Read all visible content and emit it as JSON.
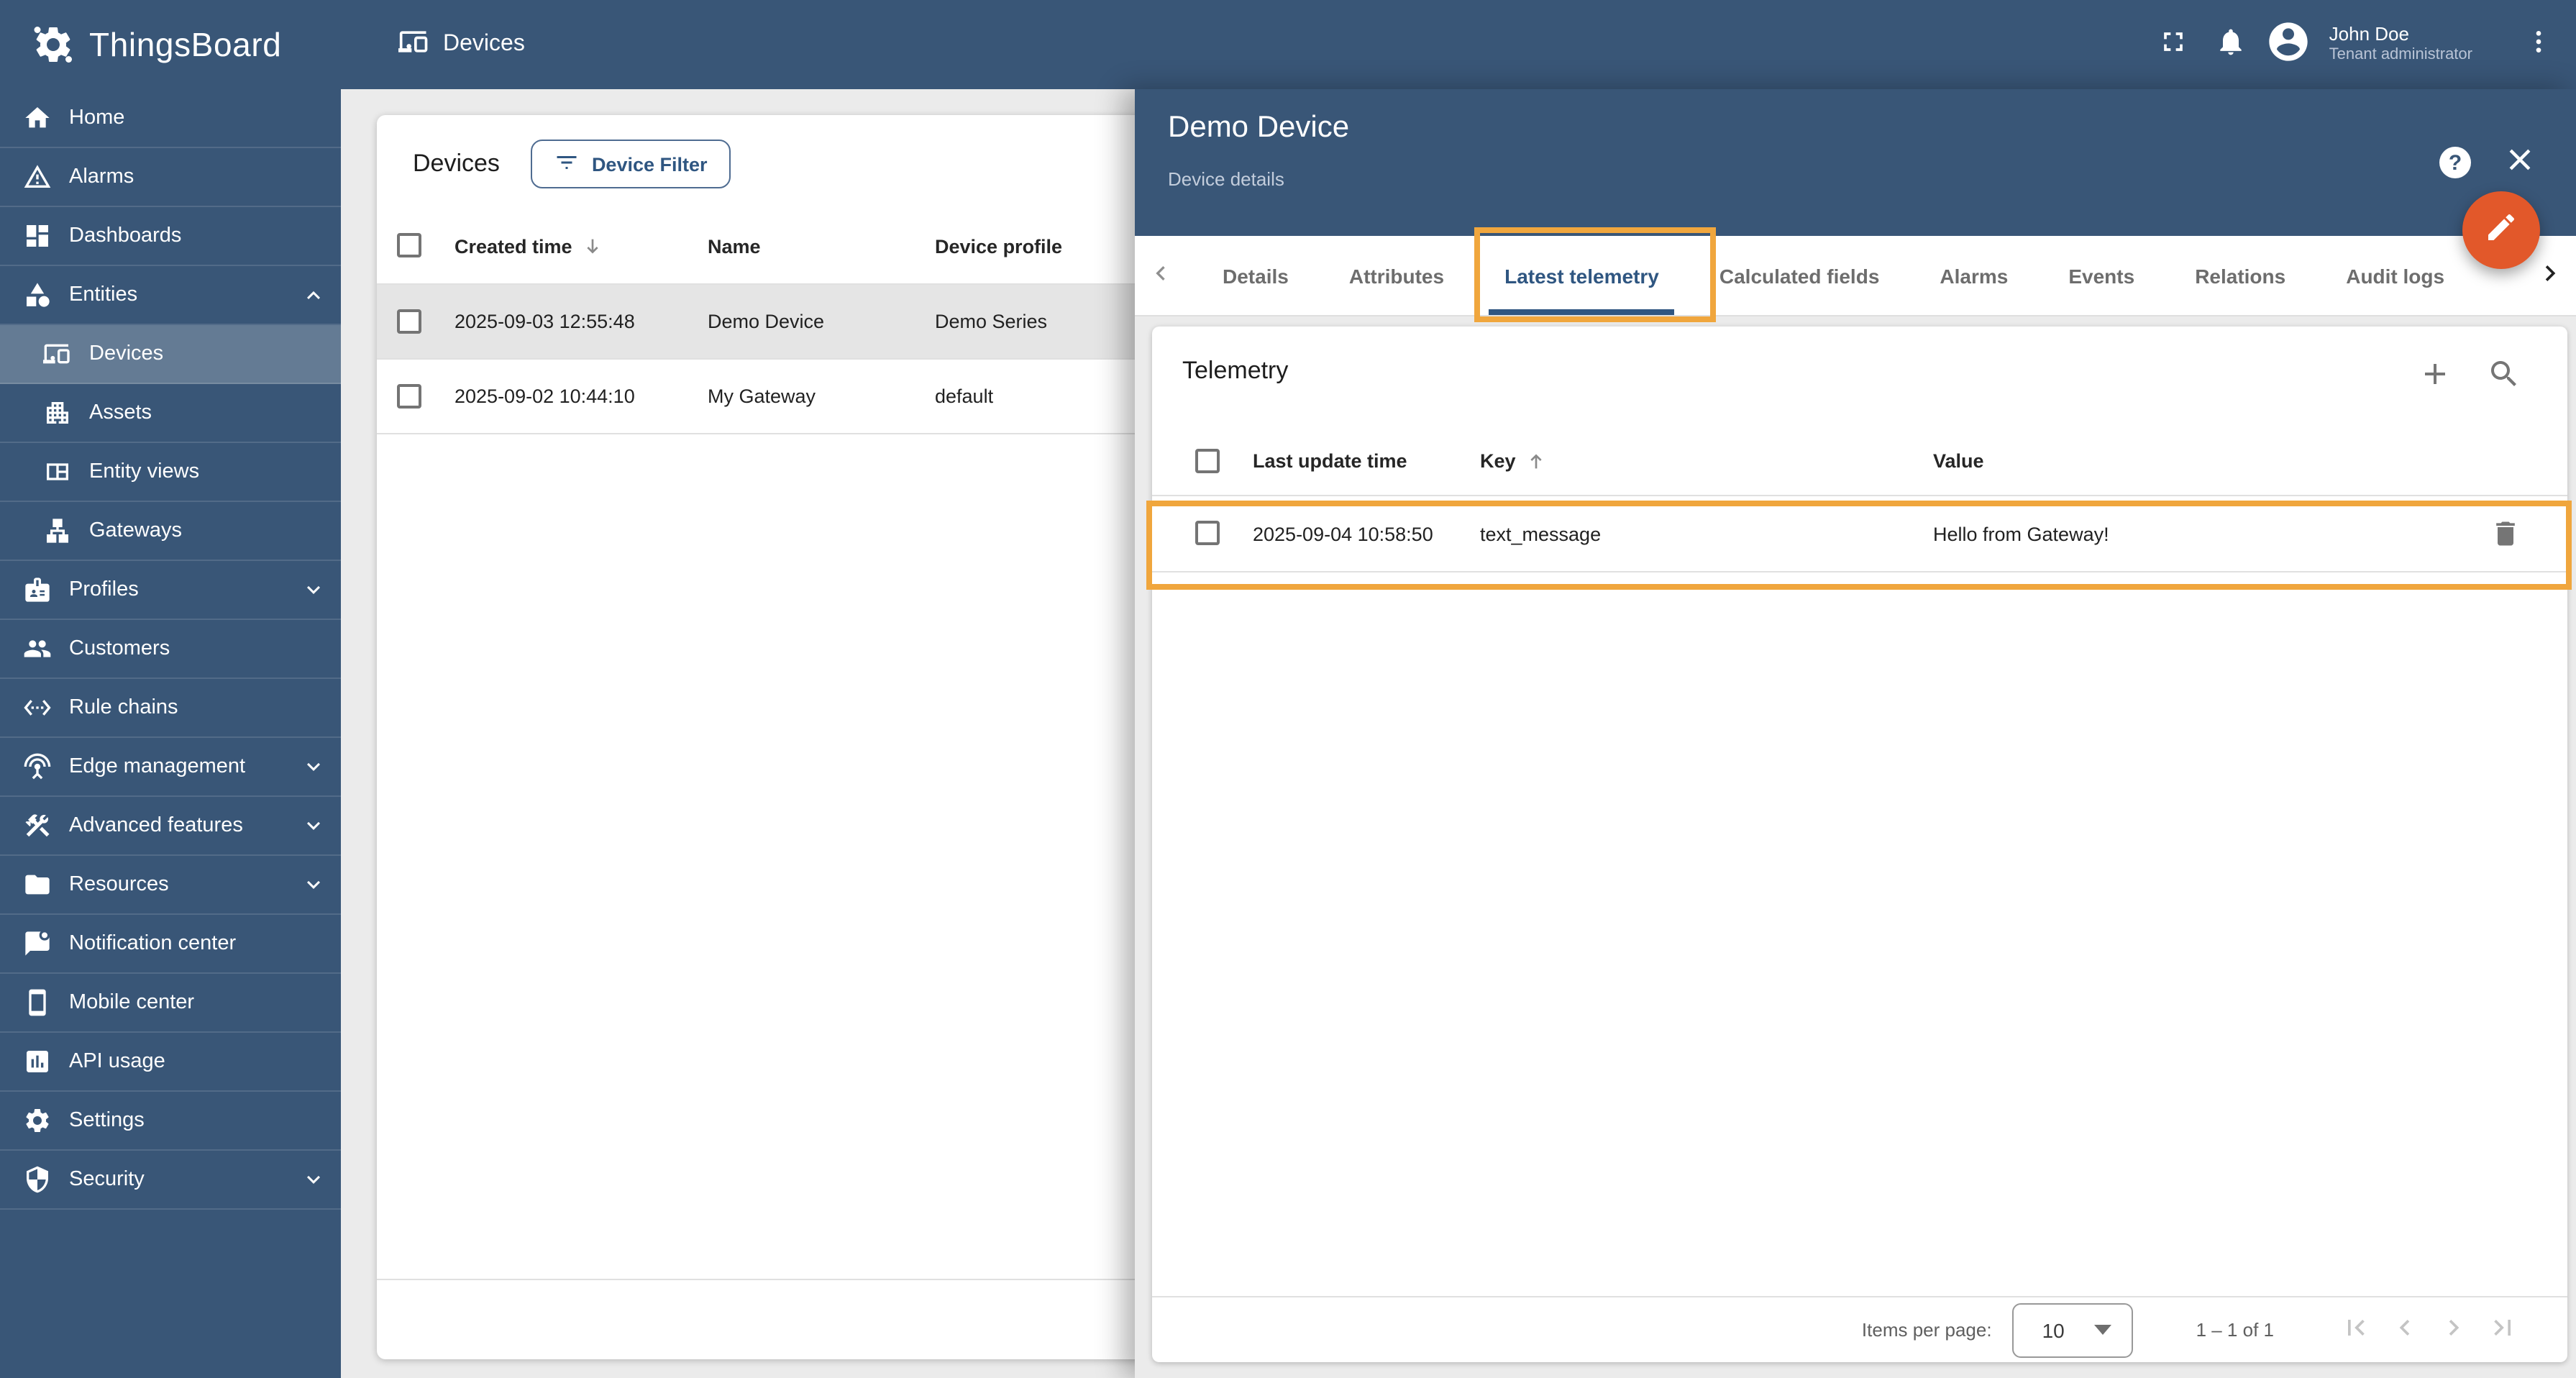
{
  "header": {
    "brand": "ThingsBoard",
    "page_title": "Devices",
    "user": {
      "name": "John Doe",
      "role": "Tenant administrator"
    }
  },
  "sidebar": {
    "items": [
      {
        "label": "Home"
      },
      {
        "label": "Alarms"
      },
      {
        "label": "Dashboards"
      },
      {
        "label": "Entities",
        "expanded": true
      },
      {
        "label": "Devices",
        "sub": true,
        "selected": true
      },
      {
        "label": "Assets",
        "sub": true
      },
      {
        "label": "Entity views",
        "sub": true
      },
      {
        "label": "Gateways",
        "sub": true
      },
      {
        "label": "Profiles",
        "collapsed": true
      },
      {
        "label": "Customers"
      },
      {
        "label": "Rule chains"
      },
      {
        "label": "Edge management",
        "collapsed": true
      },
      {
        "label": "Advanced features",
        "collapsed": true
      },
      {
        "label": "Resources",
        "collapsed": true
      },
      {
        "label": "Notification center"
      },
      {
        "label": "Mobile center"
      },
      {
        "label": "API usage"
      },
      {
        "label": "Settings"
      },
      {
        "label": "Security",
        "collapsed": true
      }
    ]
  },
  "devices_panel": {
    "title": "Devices",
    "filter_button": "Device Filter",
    "columns": {
      "created": "Created time",
      "name": "Name",
      "profile": "Device profile"
    },
    "rows": [
      {
        "created": "2025-09-03 12:55:48",
        "name": "Demo Device",
        "profile": "Demo Series",
        "selected": true
      },
      {
        "created": "2025-09-02 10:44:10",
        "name": "My Gateway",
        "profile": "default",
        "selected": false
      }
    ]
  },
  "details_panel": {
    "title": "Demo Device",
    "subtitle": "Device details",
    "help_glyph": "?",
    "tabs": [
      "Details",
      "Attributes",
      "Latest telemetry",
      "Calculated fields",
      "Alarms",
      "Events",
      "Relations",
      "Audit logs"
    ],
    "active_tab": "Latest telemetry",
    "telemetry": {
      "title": "Telemetry",
      "columns": {
        "time": "Last update time",
        "key": "Key",
        "value": "Value"
      },
      "rows": [
        {
          "time": "2025-09-04 10:58:50",
          "key": "text_message",
          "value": "Hello from Gateway!"
        }
      ],
      "paginator": {
        "label": "Items per page:",
        "page_size": "10",
        "range": "1 – 1 of 1"
      }
    }
  },
  "colors": {
    "primary_blue": "#395677",
    "fab_orange": "#e2582a",
    "annotation_orange": "#f0a63d",
    "active_tab_blue": "#2f5681",
    "selected_row_gray": "#e5e5e5"
  }
}
